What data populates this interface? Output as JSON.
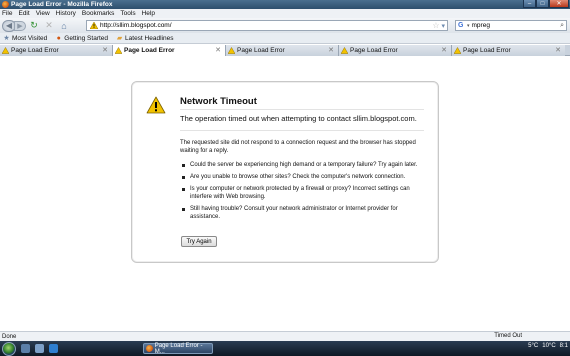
{
  "window": {
    "title": "Page Load Error - Mozilla Firefox"
  },
  "menu": [
    "File",
    "Edit",
    "View",
    "History",
    "Bookmarks",
    "Tools",
    "Help"
  ],
  "nav": {
    "url": "http://sllim.blogspot.com/",
    "search_value": "mpreg"
  },
  "bookmarks": [
    {
      "label": "Most Visited",
      "icon": "star-folder-icon"
    },
    {
      "label": "Getting Started",
      "icon": "firefox-icon"
    },
    {
      "label": "Latest Headlines",
      "icon": "rss-folder-icon"
    }
  ],
  "tabs": [
    {
      "label": "Page Load Error",
      "active": false
    },
    {
      "label": "Page Load Error",
      "active": true
    },
    {
      "label": "Page Load Error",
      "active": false
    },
    {
      "label": "Page Load Error",
      "active": false
    },
    {
      "label": "Page Load Error",
      "active": false
    }
  ],
  "error": {
    "title": "Network Timeout",
    "description": "The operation timed out when attempting to contact sllim.blogspot.com.",
    "intro": "The requested site did not respond to a connection request and the browser has stopped waiting for a reply.",
    "bullets": [
      "Could the server be experiencing high demand or a temporary failure? Try again later.",
      "Are you unable to browse other sites? Check the computer's network connection.",
      "Is your computer or network protected by a firewall or proxy? Incorrect settings can interfere with Web browsing.",
      "Still having trouble? Consult your network administrator or Internet provider for assistance."
    ],
    "button": "Try Again"
  },
  "status": {
    "left": "Done",
    "right": "Timed Out"
  },
  "taskbar": {
    "task_label": "Page Load Error - M...",
    "temp1": "5°C",
    "temp2": "10°C",
    "time": "8:1"
  },
  "colors": {
    "warning": "#f2c200",
    "accent": "#3a6cb2"
  }
}
